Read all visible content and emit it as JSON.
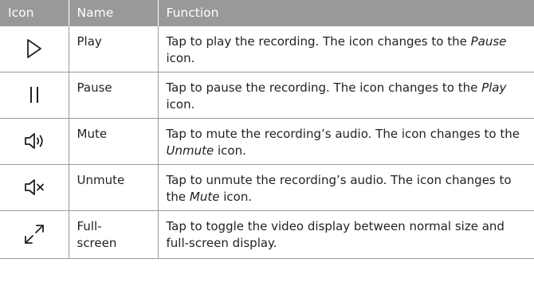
{
  "headers": {
    "icon": "Icon",
    "name": "Name",
    "function": "Function"
  },
  "rows": [
    {
      "icon": "play-icon",
      "name": "Play",
      "desc_before": "Tap to play the recording. The icon changes to the ",
      "desc_em": "Pause",
      "desc_after": " icon."
    },
    {
      "icon": "pause-icon",
      "name": "Pause",
      "desc_before": "Tap to pause the recording. The icon changes to the ",
      "desc_em": "Play",
      "desc_after": " icon."
    },
    {
      "icon": "mute-icon",
      "name": "Mute",
      "desc_before": "Tap to mute the recording’s audio. The icon changes to the ",
      "desc_em": "Unmute",
      "desc_after": " icon."
    },
    {
      "icon": "unmute-icon",
      "name": "Unmute",
      "desc_before": "Tap to unmute the recording’s audio. The icon changes to the ",
      "desc_em": "Mute",
      "desc_after": " icon."
    },
    {
      "icon": "fullscreen-icon",
      "name": "Full-\nscreen",
      "desc_before": "Tap to toggle the video display between normal size and full-screen display.",
      "desc_em": "",
      "desc_after": ""
    }
  ],
  "colors": {
    "header_bg": "#999999",
    "header_text": "#ffffff",
    "border": "#9a9a9a",
    "text": "#231f20"
  }
}
